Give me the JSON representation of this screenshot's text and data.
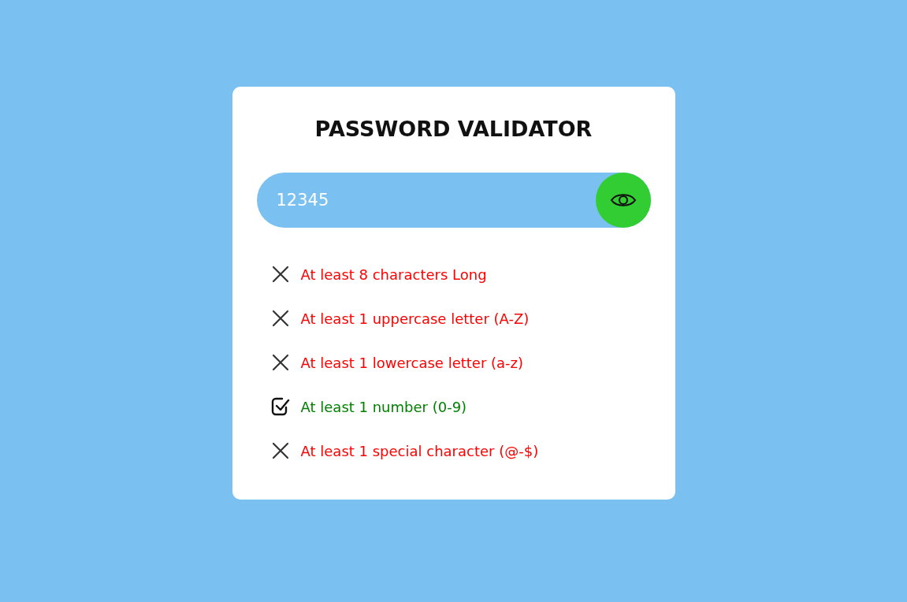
{
  "title": "PASSWORD VALIDATOR",
  "password": {
    "value": "12345"
  },
  "rules": [
    {
      "label": "At least 8 characters Long",
      "met": false
    },
    {
      "label": "At least 1 uppercase letter (A-Z)",
      "met": false
    },
    {
      "label": "At least 1 lowercase letter (a-z)",
      "met": false
    },
    {
      "label": "At least 1 number (0-9)",
      "met": true
    },
    {
      "label": "At least 1 special character (@-$)",
      "met": false
    }
  ]
}
